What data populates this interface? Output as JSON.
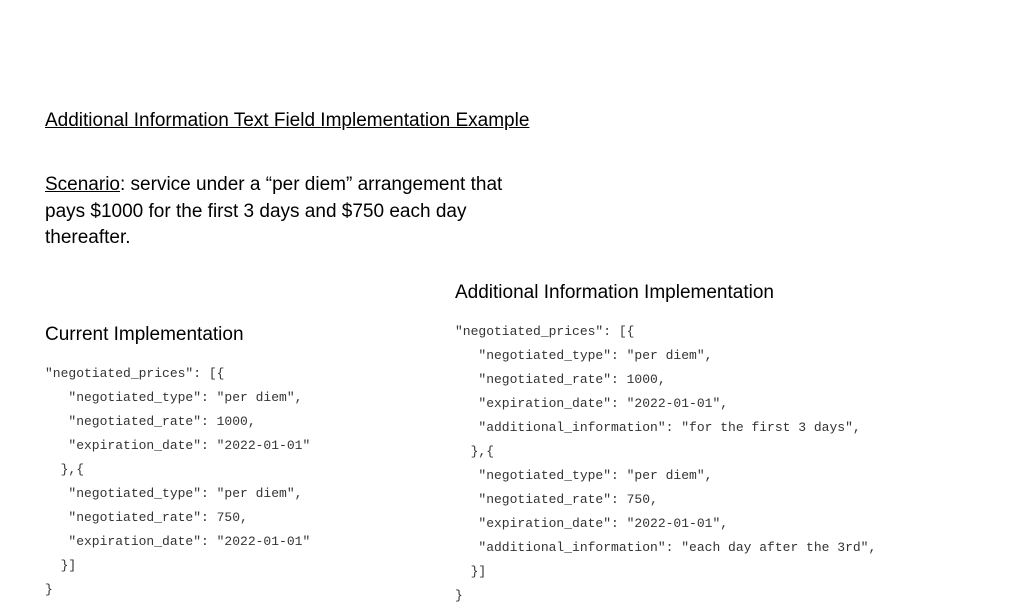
{
  "title": "Additional Information Text Field Implementation Example",
  "scenarioLabel": "Scenario",
  "scenarioText": ": service under a “per diem” arrangement that pays $1000 for the first 3 days and $750 each day thereafter.",
  "leftHeading": "Current Implementation",
  "rightHeading": "Additional Information Implementation",
  "leftCode": "\"negotiated_prices\": [{\n   \"negotiated_type\": \"per diem\",\n   \"negotiated_rate\": 1000,\n   \"expiration_date\": \"2022-01-01\"\n  },{\n   \"negotiated_type\": \"per diem\",\n   \"negotiated_rate\": 750,\n   \"expiration_date\": \"2022-01-01\"\n  }]\n}",
  "rightCode": "\"negotiated_prices\": [{\n   \"negotiated_type\": \"per diem\",\n   \"negotiated_rate\": 1000,\n   \"expiration_date\": \"2022-01-01\",\n   \"additional_information\": \"for the first 3 days\",\n  },{\n   \"negotiated_type\": \"per diem\",\n   \"negotiated_rate\": 750,\n   \"expiration_date\": \"2022-01-01\",\n   \"additional_information\": \"each day after the 3rd\",\n  }]\n}"
}
